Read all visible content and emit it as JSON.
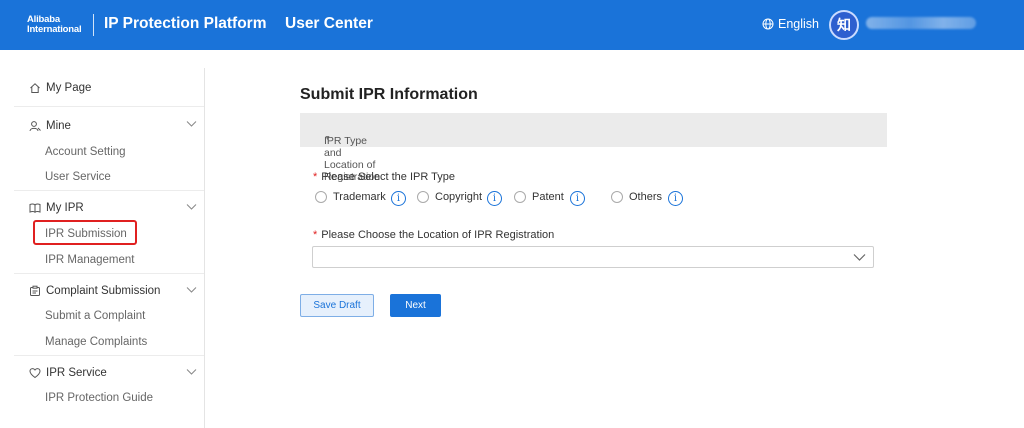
{
  "header": {
    "logo_line1": "Alibaba",
    "logo_line2": "International",
    "platform_title": "IP Protection Platform",
    "section_title": "User Center",
    "language": "English",
    "avatar_char": "知"
  },
  "sidebar": {
    "my_page": "My Page",
    "groups": [
      {
        "label": "Mine",
        "items": [
          "Account Setting",
          "User Service"
        ]
      },
      {
        "label": "My IPR",
        "items": [
          "IPR Submission",
          "IPR Management"
        ]
      },
      {
        "label": "Complaint Submission",
        "items": [
          "Submit a Complaint",
          "Manage Complaints"
        ]
      },
      {
        "label": "IPR Service",
        "items": [
          "IPR Protection Guide"
        ]
      }
    ],
    "highlighted_item": "IPR Submission"
  },
  "main": {
    "title": "Submit IPR Information",
    "section_label": "IPR Type and Location of Registration",
    "ipr_type_label": "Please Select the IPR Type",
    "ipr_types": [
      "Trademark",
      "Copyright",
      "Patent",
      "Others"
    ],
    "location_label": "Please Choose the Location of IPR Registration",
    "location_value": "",
    "save_draft_label": "Save Draft",
    "next_label": "Next"
  },
  "colors": {
    "brand": "#1a73d9",
    "required": "#e02020",
    "highlight_box": "#e02020"
  },
  "icons": {
    "language": "globe-icon",
    "my_page": "home-icon",
    "mine": "user-icon",
    "my_ipr": "book-icon",
    "complaint": "clipboard-icon",
    "ipr_service": "heart-icon",
    "expand": "chevron-down-icon",
    "info": "info-icon",
    "section": "triangle-down-icon"
  }
}
